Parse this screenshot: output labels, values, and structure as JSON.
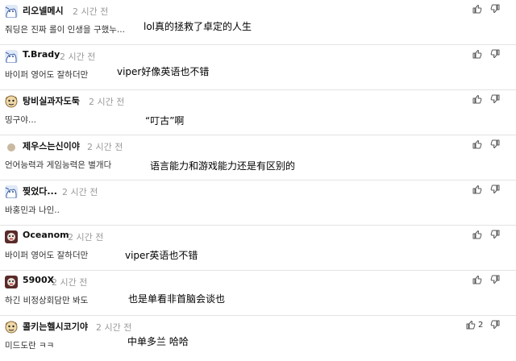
{
  "comments": [
    {
      "user": "리오넬메시",
      "time": "2 시간 전",
      "text": "줘딩은 진짜 롤이 인생을 구했누...",
      "note": "lol真的拯救了卓定的人生",
      "avatar": "blue-white-mascot",
      "votes": ""
    },
    {
      "user": "T.Brady",
      "time": "2 시간 전",
      "text": "바이퍼 영어도 잘하더만",
      "note": "viper好像英语也不错",
      "avatar": "blue-white-mascot",
      "votes": ""
    },
    {
      "user": "탕비실과자도둑",
      "time": "2 시간 전",
      "text": "띵구야...",
      "note": "“叮古”啊",
      "avatar": "cartoon-face",
      "votes": ""
    },
    {
      "user": "제우스는신이야",
      "time": "2 시간 전",
      "text": "언어능력과 게임능력은 별개다",
      "note": "语言能力和游戏能力还是有区别的",
      "avatar": "gray-circle",
      "votes": ""
    },
    {
      "user": "찢었다...",
      "time": "2 시간 전",
      "text": "바홍민과 나인..",
      "note": "",
      "avatar": "blue-white-mascot",
      "votes": ""
    },
    {
      "user": "Oceanom",
      "time": "2 시간 전",
      "text": "바이퍼 영어도 잘하더만",
      "note": "viper英语也不错",
      "avatar": "dark-face",
      "votes": ""
    },
    {
      "user": "5900X",
      "time": "2 시간 전",
      "text": "하긴 비정상회담만 봐도",
      "note": "也是单看非首脑会谈也",
      "avatar": "dark-face",
      "votes": ""
    },
    {
      "user": "콜키는헬시코기야",
      "time": "2 시간 전",
      "text": "미드도란 ㅋㅋ",
      "note": "中单多兰 哈哈",
      "avatar": "cartoon-face",
      "votes": "2"
    }
  ]
}
